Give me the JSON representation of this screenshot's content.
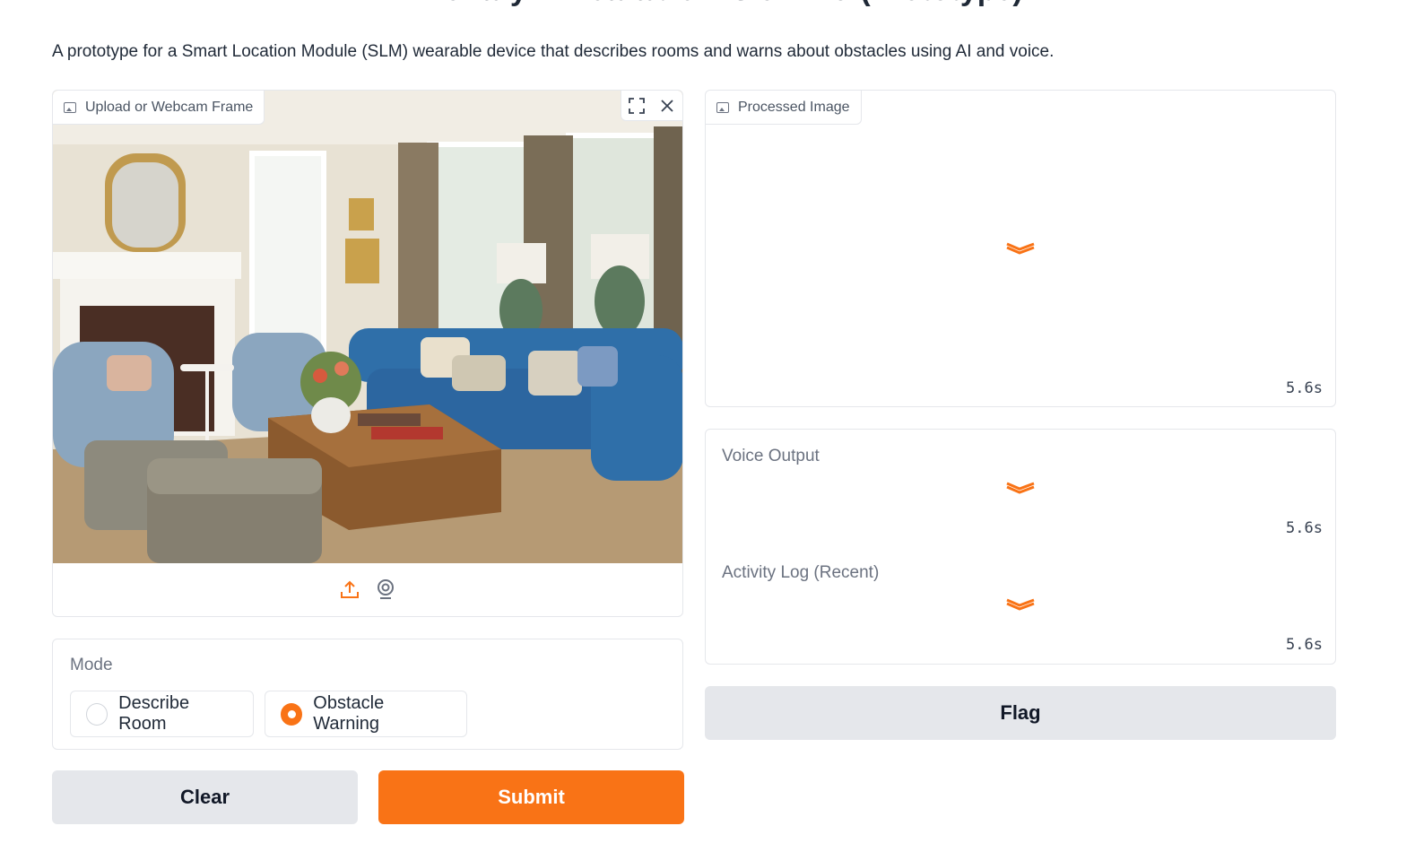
{
  "header": {
    "title": "Vizionary – Wearable Vision Aid (Prototype)",
    "description": "A prototype for a Smart Location Module (SLM) wearable device that describes rooms and warns about obstacles using AI and voice."
  },
  "input_image": {
    "label": "Upload or Webcam Frame",
    "icons": [
      "image-icon",
      "fullscreen-icon",
      "close-icon",
      "upload-icon",
      "webcam-icon"
    ]
  },
  "mode": {
    "label": "Mode",
    "options": [
      "Describe Room",
      "Obstacle Warning"
    ],
    "selected": "Obstacle Warning"
  },
  "buttons": {
    "clear": "Clear",
    "submit": "Submit",
    "flag": "Flag"
  },
  "outputs": {
    "processed_image": {
      "label": "Processed Image",
      "timer": "5.6s"
    },
    "voice_output": {
      "label": "Voice Output",
      "timer": "5.6s"
    },
    "activity_log": {
      "label": "Activity Log (Recent)",
      "timer": "5.6s"
    }
  },
  "colors": {
    "accent": "#f97316",
    "secondary_button": "#e5e7eb",
    "border": "#e5e7eb"
  }
}
